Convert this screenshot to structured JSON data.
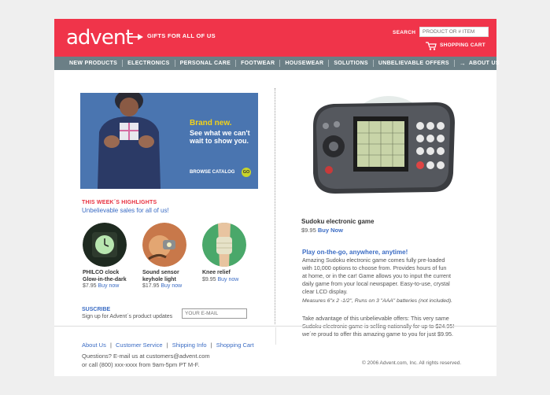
{
  "brand": {
    "logo": "advent",
    "tagline": "GIFTS FOR ALL OF US",
    "accent_color": "#f0344a",
    "nav_color": "#6b7f86",
    "link_color": "#3b6cc4"
  },
  "header": {
    "search_label": "SEARCH",
    "search_placeholder": "PRODUCT OR # ITEM",
    "cart_label": "SHOPPING CART",
    "cart_icon": "shopping-cart-icon"
  },
  "nav": {
    "items": [
      "NEW PRODUCTS",
      "ELECTRONICS",
      "PERSONAL CARE",
      "FOOTWEAR",
      "HOUSEWEAR",
      "SOLUTIONS",
      "UNBELIEVABLE OFFERS"
    ],
    "about": "ABOUT US"
  },
  "hero": {
    "title": "Brand new.",
    "text": "See what we can't wait to show you.",
    "browse": "BROWSE CATALOG",
    "go": "GO"
  },
  "highlights": {
    "title": "THIS WEEK´S HIGHLIGHTS",
    "subtitle": "Unbelievable sales for all of us!",
    "products": [
      {
        "name_line1": "PHILCO clock",
        "name_line2": "Glow-in-the-dark",
        "price": "$7.95",
        "buy": "Buy now"
      },
      {
        "name_line1": "Sound sensor",
        "name_line2": "keyhole light",
        "price": "$17.95",
        "buy": "Buy now"
      },
      {
        "name_line1": "Knee relief",
        "name_line2": "",
        "price": "$9.95",
        "buy": "Buy now"
      }
    ]
  },
  "subscribe": {
    "title": "SUSCRIBE",
    "text": "Sign up for Advent´s product updates",
    "placeholder": "YOUR E-MAIL"
  },
  "featured": {
    "title": "Sudoku electronic game",
    "price": "$9.95",
    "buy": "Buy Now",
    "desc_title": "Play on-the-go, anywhere, anytime!",
    "desc_lines": [
      "Amazing Sudoku electronic game comes fully pre-loaded",
      "with 10,000 options to choose from. Provides hours of fun",
      "at home, or in the car! Game allows you  to input the current",
      "daily game from your local newspaper. Easy-to-use, crystal",
      "clear LCD display."
    ],
    "note": "Measures 6\"x 2 -1/2\", Runs on 3 \"AAA\" batteries (not included).",
    "offer_lines": [
      "Take advantage of this unbelievable offers: This very same",
      "Sudoku electronic game is selling nationally for up to $24.95!",
      "we´re proud to offer this amazing game to you for just $9.95."
    ]
  },
  "footer": {
    "links": [
      "About Us",
      "Customer Service",
      "Shipping Info",
      "Shopping Cart"
    ],
    "separator": "|",
    "contact_line1": "Questions? E-mail us at customers@advent.com",
    "contact_line2": "or call (800) xxx-xxxx from 9am-5pm PT M-F.",
    "copyright": "© 2006 Advent.com, Inc. All rights reserved."
  }
}
